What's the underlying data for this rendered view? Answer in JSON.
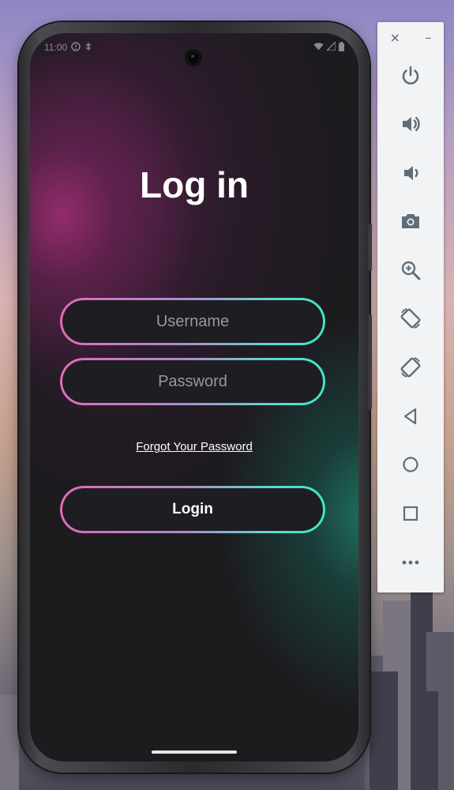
{
  "status_bar": {
    "time": "11:00"
  },
  "login": {
    "title": "Log in",
    "username_placeholder": "Username",
    "password_placeholder": "Password",
    "forgot_link": "Forgot Your Password",
    "login_button": "Login"
  },
  "colors": {
    "gradient_pink": "#e26ab8",
    "gradient_teal": "#3de6c6",
    "screen_bg": "#1c1b1e",
    "emulator_icon": "#5f6d7a"
  },
  "emulator": {
    "window_controls": [
      "×",
      "–"
    ],
    "buttons": [
      "power-icon",
      "volume-up-icon",
      "volume-down-icon",
      "camera-icon",
      "zoom-in-icon",
      "rotate-left-icon",
      "rotate-right-icon",
      "back-icon",
      "home-icon",
      "overview-icon",
      "more-icon"
    ]
  }
}
